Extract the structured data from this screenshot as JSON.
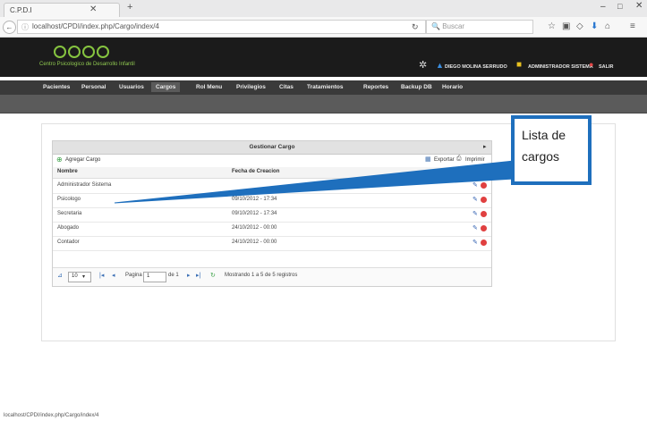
{
  "browser": {
    "tab_title": "C.P.D.I",
    "tab_close_icon": "close-icon",
    "new_tab_icon": "plus-icon",
    "url": "localhost/CPDI/index.php/Cargo/index/4",
    "search_placeholder": "Buscar",
    "status_url": "localhost/CPDI/index.php/Cargo/index/4"
  },
  "app": {
    "logo_subtitle": "Centro Psicologico de Desarrollo Infantil",
    "user_name": "DIEGO MOLINA SERRUDO",
    "role": "ADMINISTRADOR SISTEMA",
    "logout_label": "SALIR"
  },
  "menu": [
    "Pacientes",
    "Personal",
    "Usuarios",
    "Cargos",
    "Rol Menu",
    "Privilegios",
    "Citas",
    "Tratamientos",
    "Reportes",
    "Backup DB",
    "Horario"
  ],
  "menu_active": "Cargos",
  "grid": {
    "title": "Gestionar Cargo",
    "add_label": "Agregar Cargo",
    "export_label": "Exportar",
    "print_label": "Imprimir",
    "columns": {
      "name": "Nombre",
      "date": "Fecha de Creacion"
    },
    "rows": [
      {
        "name": "Administrador Sistema",
        "date": ""
      },
      {
        "name": "Psicologo",
        "date": "09/10/2012 - 17:34"
      },
      {
        "name": "Secretaria",
        "date": "09/10/2012 - 17:34"
      },
      {
        "name": "Abogado",
        "date": "24/10/2012 - 00:00"
      },
      {
        "name": "Contador",
        "date": "24/10/2012 - 00:00"
      }
    ],
    "pager": {
      "page_size": "10",
      "page_label": "Pagina",
      "page_value": "1",
      "of_label": "de 1",
      "summary": "Mostrando 1 a 5 de 5 registros"
    }
  },
  "callout": {
    "text": "Lista de cargos"
  },
  "colors": {
    "header_bg": "#1b1b1b",
    "logo_green": "#86c440",
    "callout_blue": "#1e6fbd"
  }
}
